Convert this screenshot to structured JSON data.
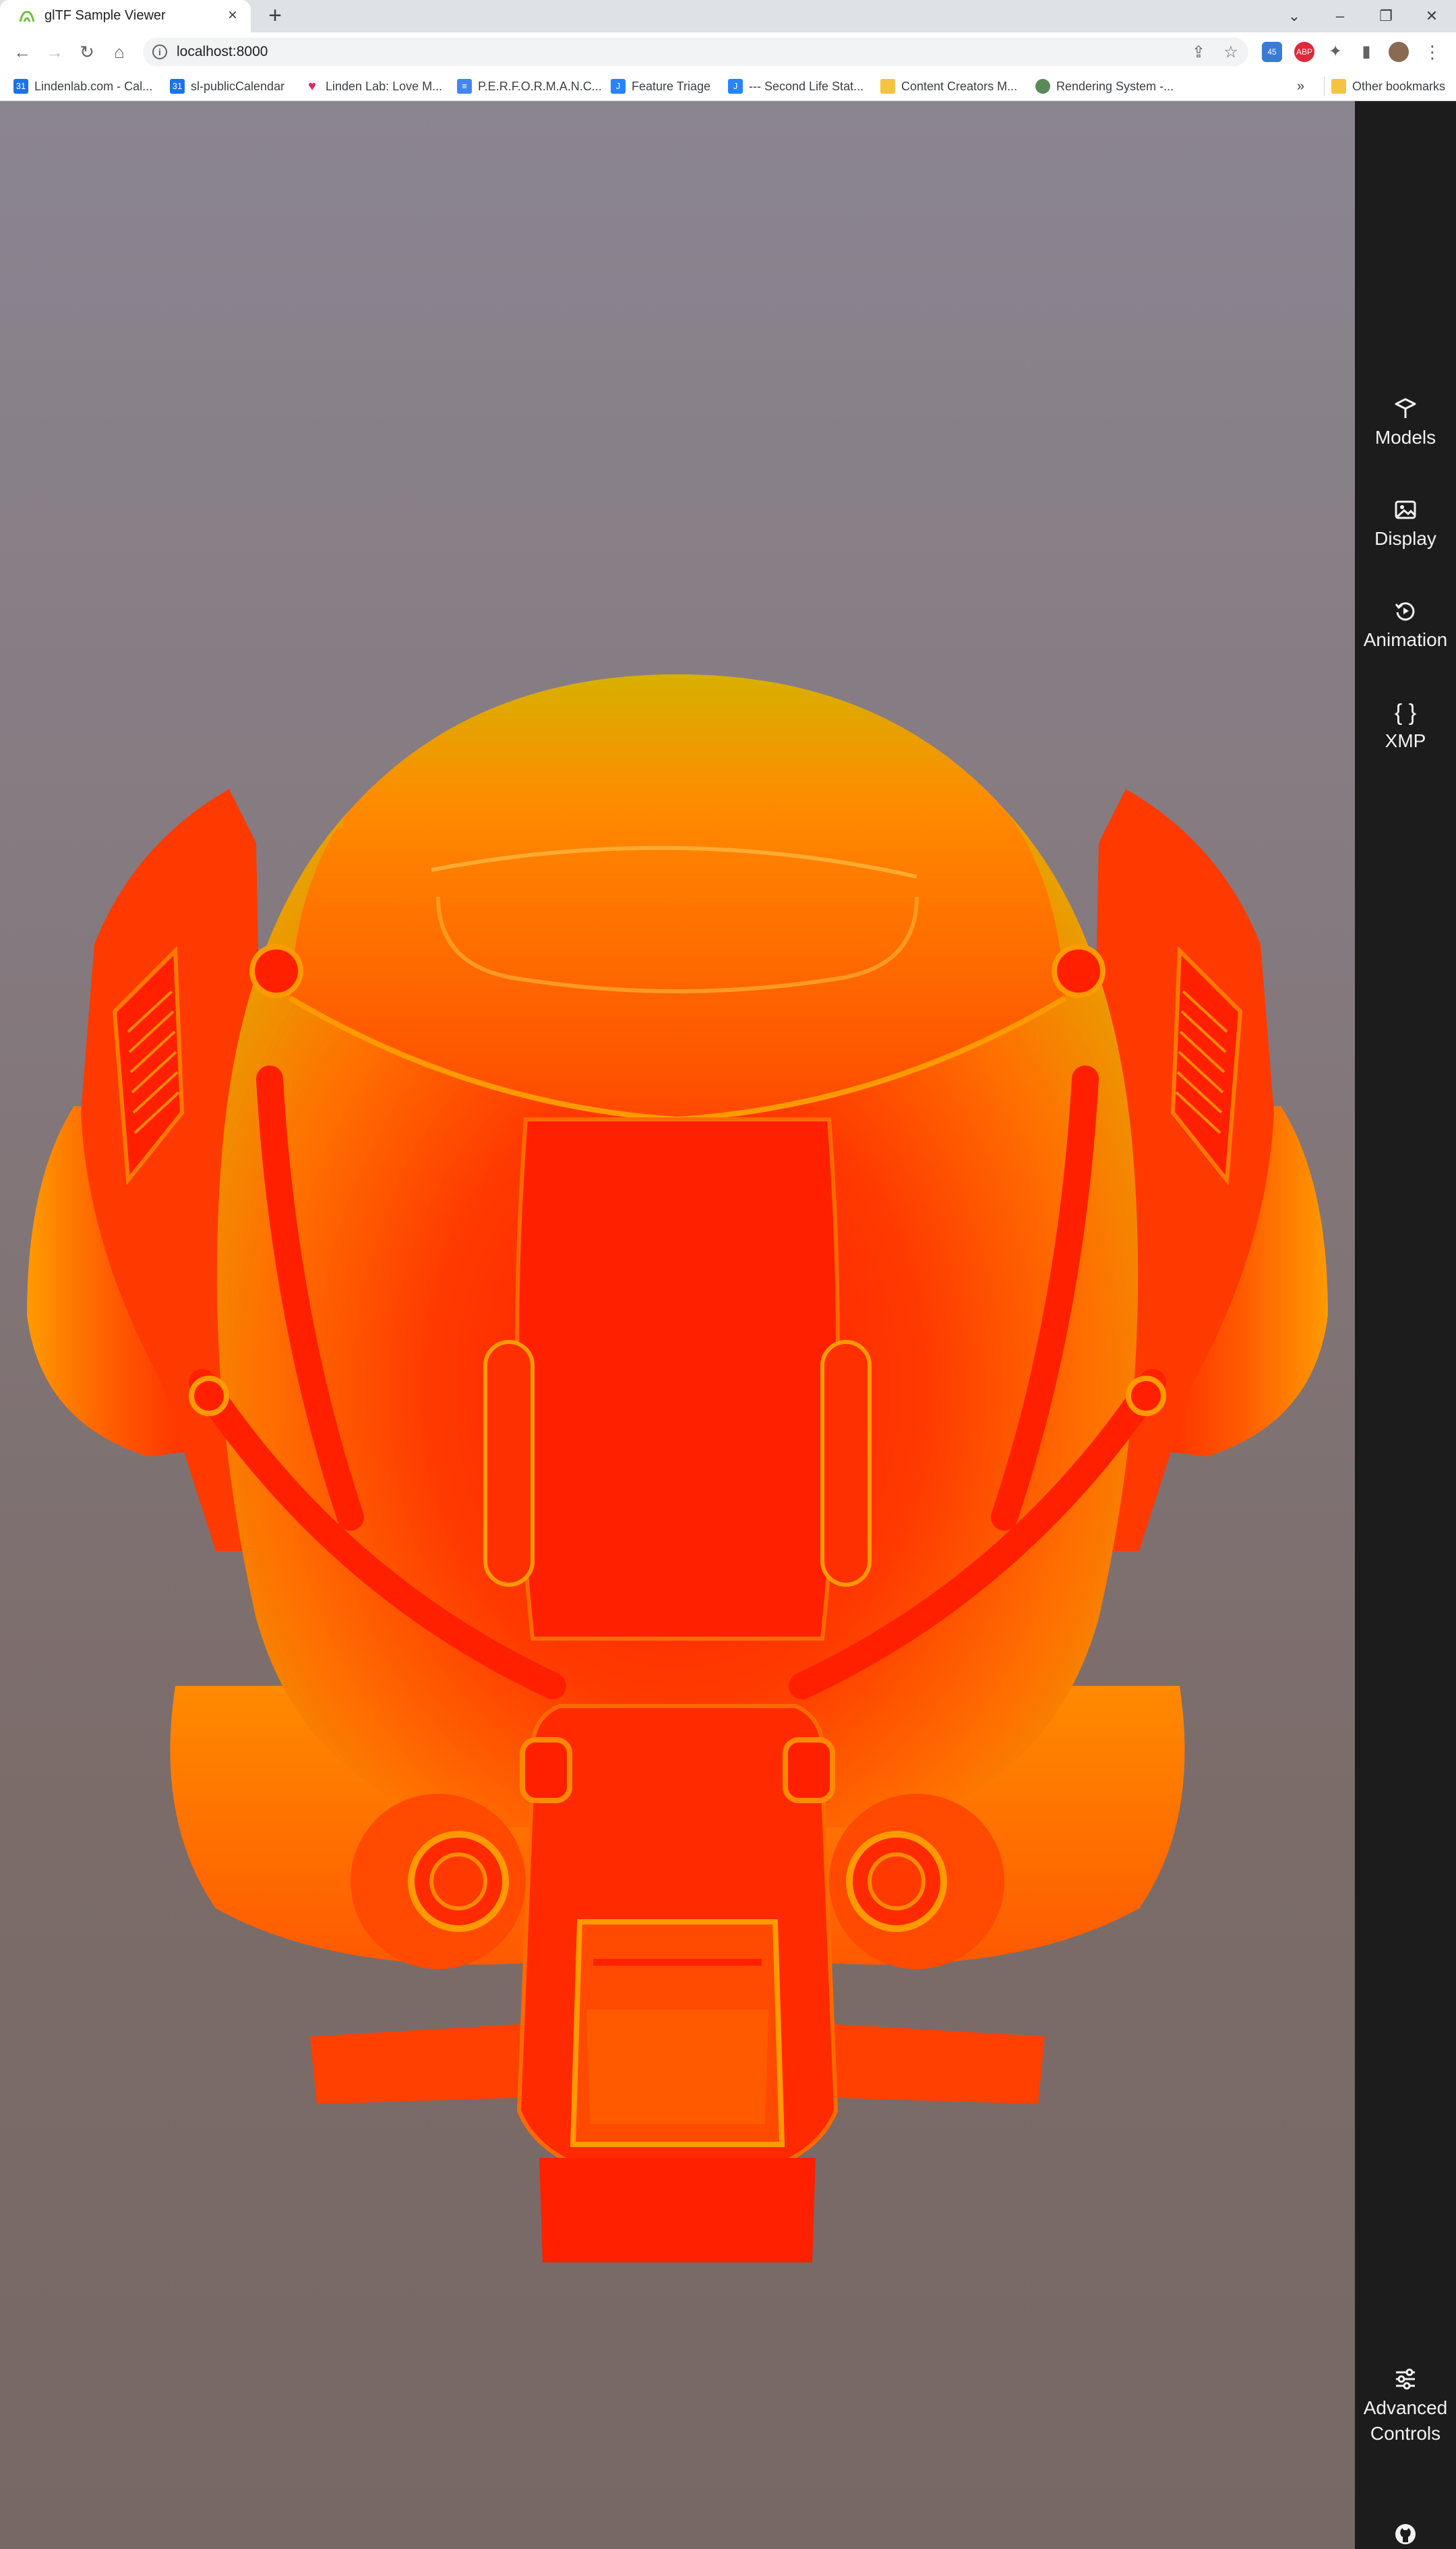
{
  "browser": {
    "tab_title": "glTF Sample Viewer",
    "url": "localhost:8000"
  },
  "bookmarks": [
    {
      "label": "Lindenlab.com - Cal...",
      "icon": "calendar-icon",
      "color": "#1a73e8"
    },
    {
      "label": "sl-publicCalendar",
      "icon": "calendar-icon",
      "color": "#1a73e8"
    },
    {
      "label": "Linden Lab: Love M...",
      "icon": "heart-icon",
      "color": "#e0245e"
    },
    {
      "label": "P.E.R.F.O.R.M.A.N.C...",
      "icon": "docs-icon",
      "color": "#4285f4"
    },
    {
      "label": "Feature Triage",
      "icon": "jira-icon",
      "color": "#2684ff"
    },
    {
      "label": "--- Second Life Stat...",
      "icon": "jira-icon",
      "color": "#2684ff"
    },
    {
      "label": "Content Creators M...",
      "icon": "folder-icon",
      "color": "#f5c342"
    },
    {
      "label": "Rendering System -...",
      "icon": "globe-icon",
      "color": "#5a8a5a"
    }
  ],
  "bookmarks_overflow": "»",
  "other_bookmarks": "Other bookmarks",
  "extension_badge": "45",
  "sidebar": {
    "models": "Models",
    "display": "Display",
    "animation": "Animation",
    "xmp": "XMP",
    "xmp_glyph": "{ }",
    "advanced_line1": "Advanced",
    "advanced_line2": "Controls"
  },
  "colors": {
    "helmet_primary": "#ff2a00",
    "helmet_secondary": "#ff7a00",
    "helmet_highlight": "#e8b400",
    "sidebar_bg": "#1c1c1c"
  }
}
